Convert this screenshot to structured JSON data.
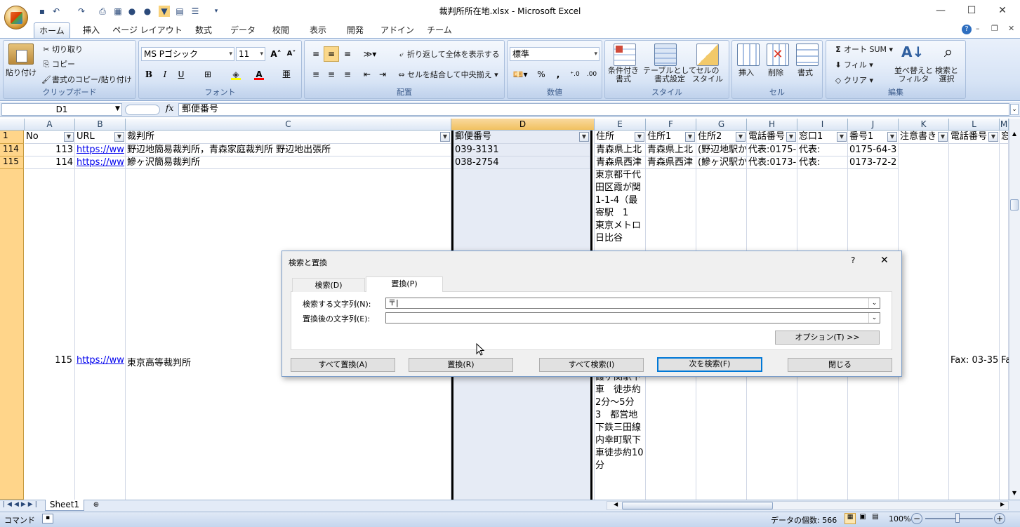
{
  "window": {
    "title": "裁判所所在地.xlsx - Microsoft Excel",
    "min": "—",
    "max": "☐",
    "close": "✕"
  },
  "ribbon_tabs": [
    "ホーム",
    "挿入",
    "ページ レイアウト",
    "数式",
    "データ",
    "校閲",
    "表示",
    "開発",
    "アドイン",
    "チーム"
  ],
  "clipboard": {
    "paste": "貼り付け",
    "cut": "切り取り",
    "copy": "コピー",
    "format_painter": "書式のコピー/貼り付け",
    "label": "クリップボード"
  },
  "font": {
    "name": "MS Pゴシック",
    "size": "11",
    "label": "フォント",
    "bold": "B",
    "italic": "I",
    "underline": "U",
    "color_a": "A"
  },
  "alignment": {
    "wrap": "折り返して全体を表示する",
    "merge": "セルを結合して中央揃え",
    "label": "配置"
  },
  "number": {
    "format": "標準",
    "percent": "%",
    "comma": ",",
    "label": "数値",
    "inc": "⁺.0",
    "dec": ".00"
  },
  "styles": {
    "cond": "条件付き\n書式",
    "table": "テーブルとして\n書式設定",
    "cell": "セルの\nスタイル",
    "label": "スタイル"
  },
  "cells": {
    "insert": "挿入",
    "delete": "削除",
    "format": "書式",
    "label": "セル"
  },
  "editing": {
    "autosum": "オート SUM",
    "fill": "フィル",
    "clear": "クリア",
    "sort": "並べ替えと\nフィルタ",
    "find": "検索と\n選択",
    "label": "編集"
  },
  "formula_bar": {
    "name_box": "D1",
    "fx": "fx",
    "content": "郵便番号"
  },
  "columns": [
    "A",
    "B",
    "C",
    "D",
    "E",
    "F",
    "G",
    "H",
    "I",
    "J",
    "K",
    "L",
    "M"
  ],
  "header_row": {
    "num": "1",
    "cells": [
      "No",
      "URL",
      "裁判所",
      "郵便番号",
      "住所",
      "住所1",
      "住所2",
      "電話番号",
      "窓口1",
      "番号1",
      "注意書き",
      "電話番号",
      "窓"
    ]
  },
  "rows": [
    {
      "num": "114",
      "no": "113",
      "url": "https://ww",
      "court": "野辺地簡易裁判所，青森家庭裁判所 野辺地出張所",
      "zip": "039-3131",
      "addr": "青森県上北",
      "addr1": "青森県上北",
      "addr2": "(野辺地駅か",
      "tel": "代表:0175-",
      "win": "代表:",
      "n1": "0175-64-3"
    },
    {
      "num": "115",
      "no": "114",
      "url": "https://ww",
      "court": "鰺ヶ沢簡易裁判所",
      "zip": "038-2754",
      "addr": "青森県西津",
      "addr1": "青森県西津",
      "addr2": "(鰺ヶ沢駅か",
      "tel": "代表:0173-",
      "win": "代表:",
      "n1": "0173-72-2"
    }
  ],
  "big_row": {
    "no": "115",
    "url": "https://ww",
    "court": "東京高等裁判所",
    "fax": "Fax: 03-35",
    "m": "Fa",
    "addr_top": "東京都千代田区霞が関1-1-4（最寄駅　1　東京メトロ日比谷",
    "addr_bottom": "霞ヶ関駅下車　徒歩約2分〜5分\n3　都営地下鉄三田線　内幸町駅下車徒歩約10分"
  },
  "sheet_tab": "Sheet1",
  "status": {
    "mode": "コマンド",
    "count": "データの個数: 566",
    "zoom": "100%"
  },
  "dialog": {
    "title": "検索と置換",
    "help": "?",
    "close": "✕",
    "tab_find": "検索(D)",
    "tab_replace": "置換(P)",
    "find_label": "検索する文字列(N):",
    "find_value": "〒|",
    "replace_label": "置換後の文字列(E):",
    "replace_value": "",
    "options": "オプション(T) >>",
    "replace_all": "すべて置換(A)",
    "replace": "置換(R)",
    "find_all": "すべて検索(I)",
    "find_next": "次を検索(F)",
    "close_btn": "閉じる"
  }
}
